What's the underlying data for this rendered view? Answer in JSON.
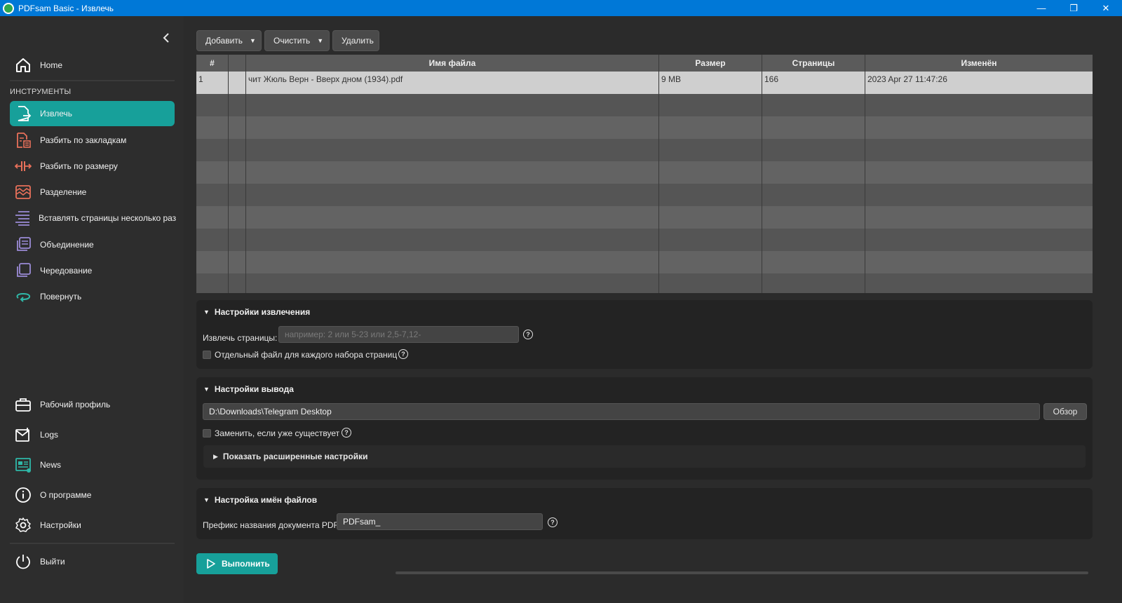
{
  "window": {
    "title": "PDFsam Basic - Извлечь",
    "minimize": "—",
    "restore": "❐",
    "close": "✕"
  },
  "sidebar": {
    "home": "Home",
    "section_label": "ИНСТРУМЕНТЫ",
    "tools": [
      {
        "label": "Извлечь",
        "icon": "extract-icon"
      },
      {
        "label": "Разбить по закладкам",
        "icon": "split-bookmarks-icon"
      },
      {
        "label": "Разбить по размеру",
        "icon": "split-size-icon"
      },
      {
        "label": "Разделение",
        "icon": "split-icon"
      },
      {
        "label": "Вставлять страницы несколько раз",
        "icon": "insert-pages-icon"
      },
      {
        "label": "Объединение",
        "icon": "merge-icon"
      },
      {
        "label": "Чередование",
        "icon": "alternate-mix-icon"
      },
      {
        "label": "Повернуть",
        "icon": "rotate-icon"
      }
    ],
    "bottom": [
      {
        "label": "Рабочий профиль",
        "icon": "briefcase-icon"
      },
      {
        "label": "Logs",
        "icon": "logs-icon"
      },
      {
        "label": "News",
        "icon": "news-icon"
      },
      {
        "label": "О программе",
        "icon": "info-icon"
      },
      {
        "label": "Настройки",
        "icon": "gear-icon"
      }
    ],
    "exit": "Выйти",
    "active_color": "#17a09a"
  },
  "toolbar": {
    "add": "Добавить",
    "clear": "Очистить",
    "remove": "Удалить"
  },
  "table": {
    "headers": [
      "#",
      "",
      "Имя файла",
      "Размер",
      "Страницы",
      "Изменён"
    ],
    "rows": [
      {
        "num": "1",
        "lock": "",
        "name": "чит Жюль Верн - Вверх дном (1934).pdf",
        "size": "9 MB",
        "pages": "166",
        "modified": "2023 Apr 27 11:47:26"
      }
    ]
  },
  "extract_settings": {
    "title": "Настройки извлечения",
    "pages_label": "Извлечь страницы:",
    "pages_placeholder": "например: 2 или 5-23 или 2,5-7,12-",
    "separate_label": "Отдельный файл для каждого набора страниц"
  },
  "output_settings": {
    "title": "Настройки вывода",
    "path": "D:\\Downloads\\Telegram Desktop",
    "browse": "Обзор",
    "overwrite_label": "Заменить, если уже существует",
    "advanced": "Показать расширенные настройки"
  },
  "filename_settings": {
    "title": "Настройка имён файлов",
    "prefix_label": "Префикс названия документа PDF:",
    "prefix_value": "PDFsam_"
  },
  "run": {
    "label": "Выполнить"
  }
}
